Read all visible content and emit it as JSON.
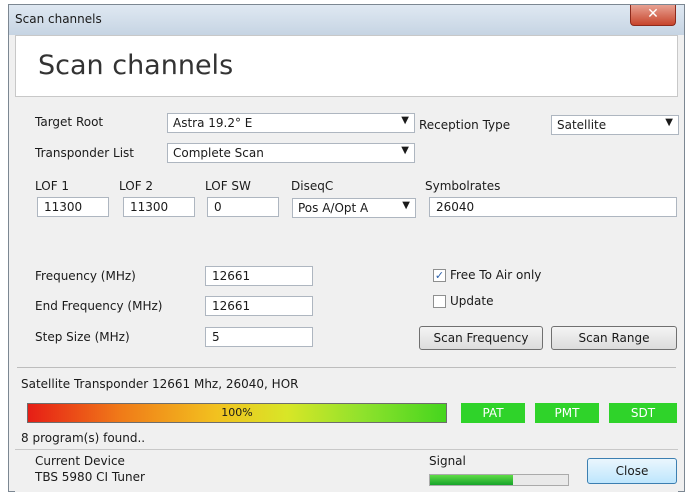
{
  "window": {
    "title": "Scan channels",
    "close_label": "✕"
  },
  "header": {
    "title": "Scan channels"
  },
  "form": {
    "target_root_label": "Target Root",
    "target_root_value": "Astra 19.2° E",
    "transponder_list_label": "Transponder List",
    "transponder_list_value": "Complete Scan",
    "reception_type_label": "Reception Type",
    "reception_type_value": "Satellite",
    "lof1_label": "LOF 1",
    "lof1_value": "11300",
    "lof2_label": "LOF 2",
    "lof2_value": "11300",
    "lofsw_label": "LOF SW",
    "lofsw_value": "0",
    "diseqc_label": "DiseqC",
    "diseqc_value": "Pos A/Opt A",
    "symbolrates_label": "Symbolrates",
    "symbolrates_value": "26040",
    "frequency_label": "Frequency (MHz)",
    "frequency_value": "12661",
    "end_frequency_label": "End  Frequency (MHz)",
    "end_frequency_value": "12661",
    "step_size_label": "Step Size (MHz)",
    "step_size_value": "5",
    "free_to_air_label": "Free To Air only",
    "free_to_air_checked": true,
    "update_label": "Update",
    "update_checked": false,
    "scan_frequency_label": "Scan Frequency",
    "scan_range_label": "Scan Range"
  },
  "status": {
    "transponder_text": "Satellite Transponder 12661 Mhz, 26040, HOR",
    "progress_text": "100%",
    "progress": 1.0,
    "tags": [
      "PAT",
      "PMT",
      "SDT"
    ],
    "programs_found": "8 program(s) found.."
  },
  "footer": {
    "device_label": "Current Device",
    "device_value": "TBS 5980 CI Tuner",
    "signal_label": "Signal",
    "signal_level": 0.6,
    "close_button": "Close"
  },
  "colors": {
    "tag_green": "#2fd32a",
    "title_bar": "#c6d4e3",
    "close_red": "#c7452c"
  }
}
